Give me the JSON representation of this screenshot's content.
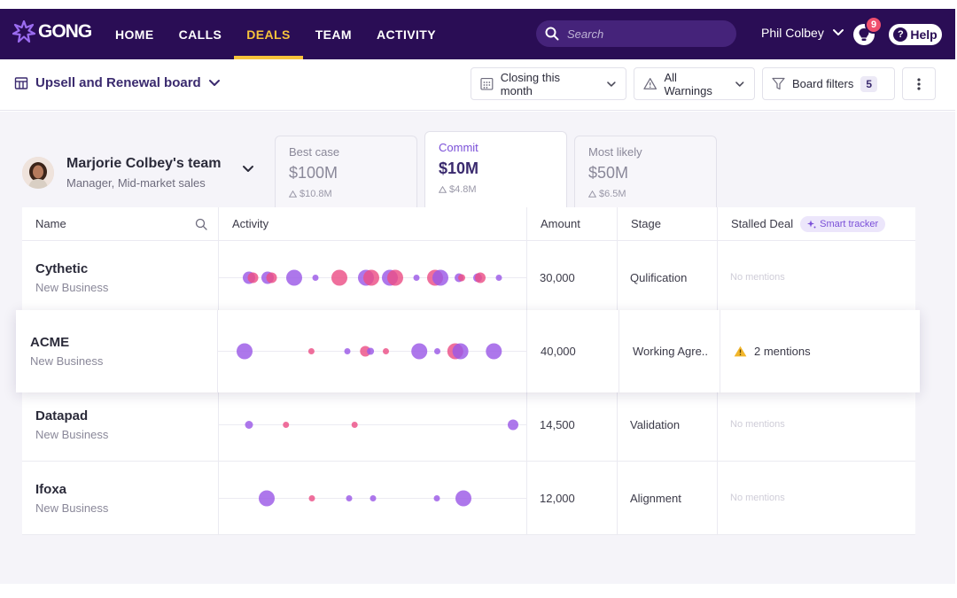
{
  "nav": {
    "logo": "GONG",
    "links": [
      "HOME",
      "CALLS",
      "DEALS",
      "TEAM",
      "ACTIVITY"
    ],
    "active": "DEALS",
    "search_placeholder": "Search",
    "user": "Phil Colbey",
    "notification_count": "9",
    "help": "Help"
  },
  "toolbar": {
    "board": "Upsell and Renewal board",
    "period": "Closing this month",
    "warnings": "All Warnings",
    "filters": "Board filters",
    "filters_count": "5"
  },
  "team": {
    "name": "Marjorie Colbey's team",
    "role": "Manager, Mid-market sales"
  },
  "forecast": [
    {
      "label": "Best case",
      "value": "$100M",
      "delta": "$10.8M"
    },
    {
      "label": "Commit",
      "value": "$10M",
      "delta": "$4.8M"
    },
    {
      "label": "Most likely",
      "value": "$50M",
      "delta": "$6.5M"
    }
  ],
  "columns": {
    "name": "Name",
    "activity": "Activity",
    "amount": "Amount",
    "stage": "Stage",
    "stalled": "Stalled Deal",
    "smart": "Smart tracker"
  },
  "colors": {
    "purple": "#9b59e6",
    "pink": "#ec4f86"
  },
  "deals": [
    {
      "name": "Cythetic",
      "type": "New Business",
      "amount": "30,000",
      "stage": "Qulification",
      "stalled": "No mentions",
      "activity": [
        {
          "pos": 0.04,
          "size": 7,
          "c": "purple"
        },
        {
          "pos": 0.055,
          "size": 6,
          "c": "pink"
        },
        {
          "pos": 0.11,
          "size": 7,
          "c": "purple"
        },
        {
          "pos": 0.125,
          "size": 6,
          "c": "pink"
        },
        {
          "pos": 0.21,
          "size": 9,
          "c": "purple"
        },
        {
          "pos": 0.29,
          "size": 3.5,
          "c": "purple"
        },
        {
          "pos": 0.38,
          "size": 9,
          "c": "pink"
        },
        {
          "pos": 0.48,
          "size": 9,
          "c": "purple"
        },
        {
          "pos": 0.5,
          "size": 9,
          "c": "pink"
        },
        {
          "pos": 0.57,
          "size": 9,
          "c": "purple"
        },
        {
          "pos": 0.59,
          "size": 9,
          "c": "pink"
        },
        {
          "pos": 0.67,
          "size": 3.5,
          "c": "purple"
        },
        {
          "pos": 0.74,
          "size": 9,
          "c": "pink"
        },
        {
          "pos": 0.76,
          "size": 9,
          "c": "purple"
        },
        {
          "pos": 0.83,
          "size": 5,
          "c": "purple"
        },
        {
          "pos": 0.84,
          "size": 4,
          "c": "pink"
        },
        {
          "pos": 0.9,
          "size": 5,
          "c": "purple"
        },
        {
          "pos": 0.91,
          "size": 6,
          "c": "pink"
        },
        {
          "pos": 0.98,
          "size": 3.5,
          "c": "purple"
        }
      ]
    },
    {
      "name": "ACME",
      "type": "New Business",
      "amount": "40,000",
      "stage": "Working Agre..",
      "stalled": "2 mentions",
      "activity": [
        {
          "pos": 0.0,
          "size": 9,
          "c": "purple"
        },
        {
          "pos": 0.26,
          "size": 3.5,
          "c": "pink"
        },
        {
          "pos": 0.4,
          "size": 3.5,
          "c": "purple"
        },
        {
          "pos": 0.47,
          "size": 6,
          "c": "pink"
        },
        {
          "pos": 0.49,
          "size": 4,
          "c": "purple"
        },
        {
          "pos": 0.55,
          "size": 3.5,
          "c": "pink"
        },
        {
          "pos": 0.68,
          "size": 9,
          "c": "purple"
        },
        {
          "pos": 0.75,
          "size": 3.5,
          "c": "purple"
        },
        {
          "pos": 0.82,
          "size": 9,
          "c": "pink"
        },
        {
          "pos": 0.84,
          "size": 9,
          "c": "purple"
        },
        {
          "pos": 0.97,
          "size": 9,
          "c": "purple"
        }
      ]
    },
    {
      "name": "Datapad",
      "type": "New Business",
      "amount": "14,500",
      "stage": "Validation",
      "stalled": "No mentions",
      "activity": [
        {
          "pos": 0.0,
          "size": 4.5,
          "c": "purple"
        },
        {
          "pos": 0.14,
          "size": 3.5,
          "c": "pink"
        },
        {
          "pos": 0.4,
          "size": 3.5,
          "c": "pink"
        },
        {
          "pos": 1.0,
          "size": 6,
          "c": "purple"
        }
      ]
    },
    {
      "name": "Ifoxa",
      "type": "New Business",
      "amount": "12,000",
      "stage": "Alignment",
      "stalled": "No mentions",
      "activity": [
        {
          "pos": 0.08,
          "size": 9,
          "c": "purple"
        },
        {
          "pos": 0.25,
          "size": 3.5,
          "c": "pink"
        },
        {
          "pos": 0.39,
          "size": 3.5,
          "c": "purple"
        },
        {
          "pos": 0.48,
          "size": 3.5,
          "c": "purple"
        },
        {
          "pos": 0.72,
          "size": 3.5,
          "c": "purple"
        },
        {
          "pos": 0.82,
          "size": 9,
          "c": "purple"
        }
      ]
    }
  ]
}
